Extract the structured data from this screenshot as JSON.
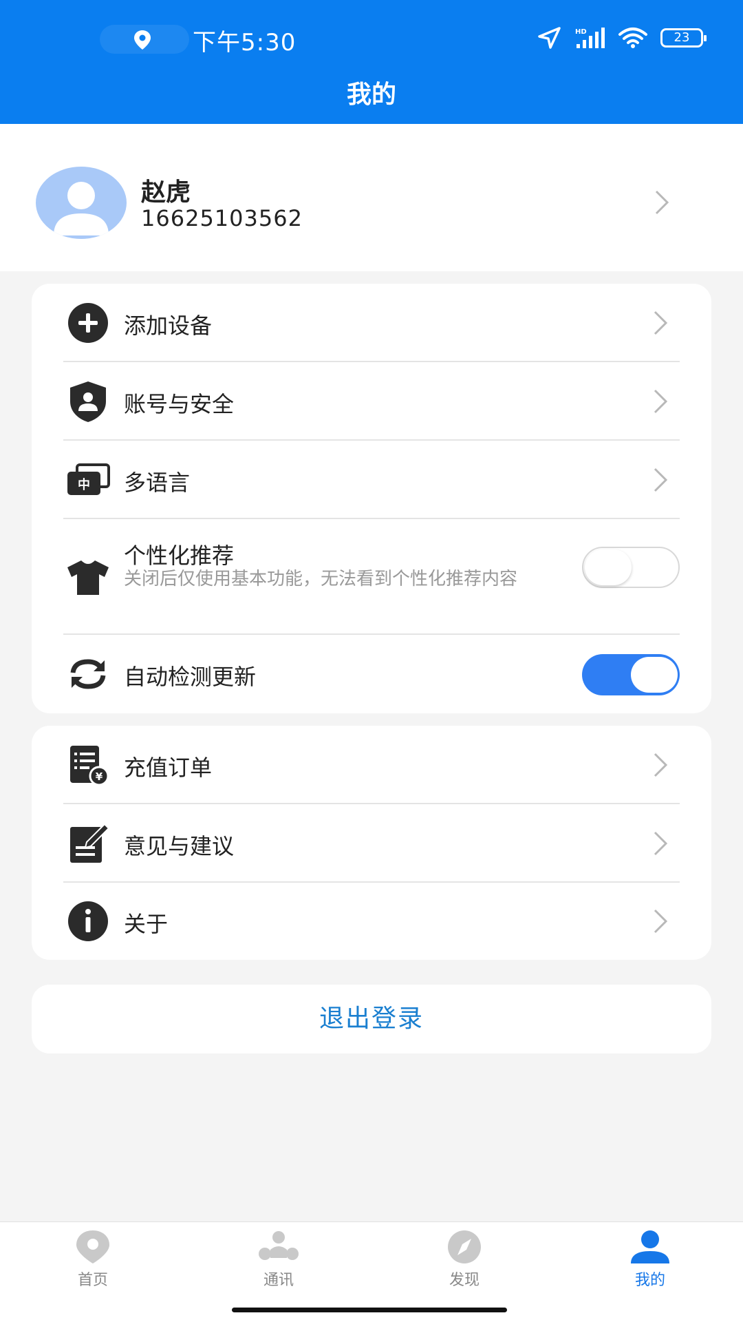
{
  "status_bar": {
    "time": "下午5:30",
    "battery": "23"
  },
  "header": {
    "title": "我的"
  },
  "profile": {
    "name": "赵虎",
    "phone": "16625103562"
  },
  "settings_group_1": [
    {
      "label": "添加设备",
      "icon": "add-circle-icon"
    },
    {
      "label": "账号与安全",
      "icon": "shield-user-icon"
    },
    {
      "label": "多语言",
      "icon": "language-icon"
    },
    {
      "label": "个性化推荐",
      "icon": "tshirt-icon",
      "description": "关闭后仅使用基本功能，无法看到个性化推荐内容",
      "toggle": false
    },
    {
      "label": "自动检测更新",
      "icon": "refresh-icon",
      "toggle": true
    }
  ],
  "settings_group_2": [
    {
      "label": "充值订单",
      "icon": "order-list-icon"
    },
    {
      "label": "意见与建议",
      "icon": "feedback-edit-icon"
    },
    {
      "label": "关于",
      "icon": "info-icon"
    }
  ],
  "logout_label": "退出登录",
  "bottom_nav": [
    {
      "label": "首页",
      "icon": "home-pin-icon",
      "active": false
    },
    {
      "label": "通讯",
      "icon": "contacts-group-icon",
      "active": false
    },
    {
      "label": "发现",
      "icon": "compass-icon",
      "active": false
    },
    {
      "label": "我的",
      "icon": "profile-icon",
      "active": true
    }
  ],
  "colors": {
    "header_blue": "#0a7ef0",
    "toggle_on": "#2f7ef3",
    "logout_text": "#1a7fd0",
    "nav_active": "#1677e8"
  }
}
